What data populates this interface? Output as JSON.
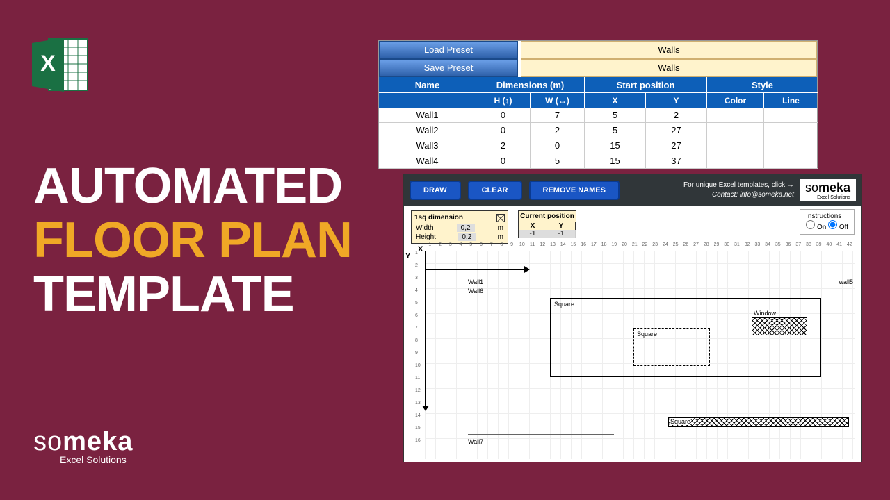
{
  "title": {
    "l1": "AUTOMATED",
    "l2": "FLOOR PLAN",
    "l3": "TEMPLATE"
  },
  "logo": {
    "brand_a": "so",
    "brand_b": "meka",
    "sub": "Excel Solutions"
  },
  "preset": {
    "load": "Load Preset",
    "save": "Save Preset",
    "walls": "Walls"
  },
  "headers": {
    "name": "Name",
    "dim": "Dimensions (m)",
    "start": "Start position",
    "style": "Style",
    "h": "H (↕)",
    "w": "W (↔)",
    "x": "X",
    "y": "Y",
    "color": "Color",
    "line": "Line"
  },
  "rows": [
    {
      "name": "Wall1",
      "h": "0",
      "w": "7",
      "x": "5",
      "y": "2"
    },
    {
      "name": "Wall2",
      "h": "0",
      "w": "2",
      "x": "5",
      "y": "27"
    },
    {
      "name": "Wall3",
      "h": "2",
      "w": "0",
      "x": "15",
      "y": "27"
    },
    {
      "name": "Wall4",
      "h": "0",
      "w": "5",
      "x": "15",
      "y": "37"
    }
  ],
  "toolbar": {
    "draw": "DRAW",
    "clear": "CLEAR",
    "remove": "REMOVE NAMES",
    "info1": "For unique Excel templates, click →",
    "info2": "Contact: info@someka.net"
  },
  "dim": {
    "title": "1sq dimension",
    "width_lbl": "Width",
    "width_val": "0,2",
    "height_lbl": "Height",
    "height_val": "0,2",
    "unit": "m"
  },
  "cp": {
    "title": "Current position",
    "x": "X",
    "y": "Y",
    "xv": "-1",
    "yv": "-1"
  },
  "instr": {
    "title": "Instructions",
    "on": "On",
    "off": "Off"
  },
  "axes": {
    "x": "X",
    "y": "Y"
  },
  "labels": {
    "wall1": "Wall1",
    "wall5": "wall5",
    "wall6": "Wall6",
    "wall7": "Wall7",
    "sq": "Square",
    "sq2": "Square",
    "win": "Window",
    "sq3": "Square"
  }
}
